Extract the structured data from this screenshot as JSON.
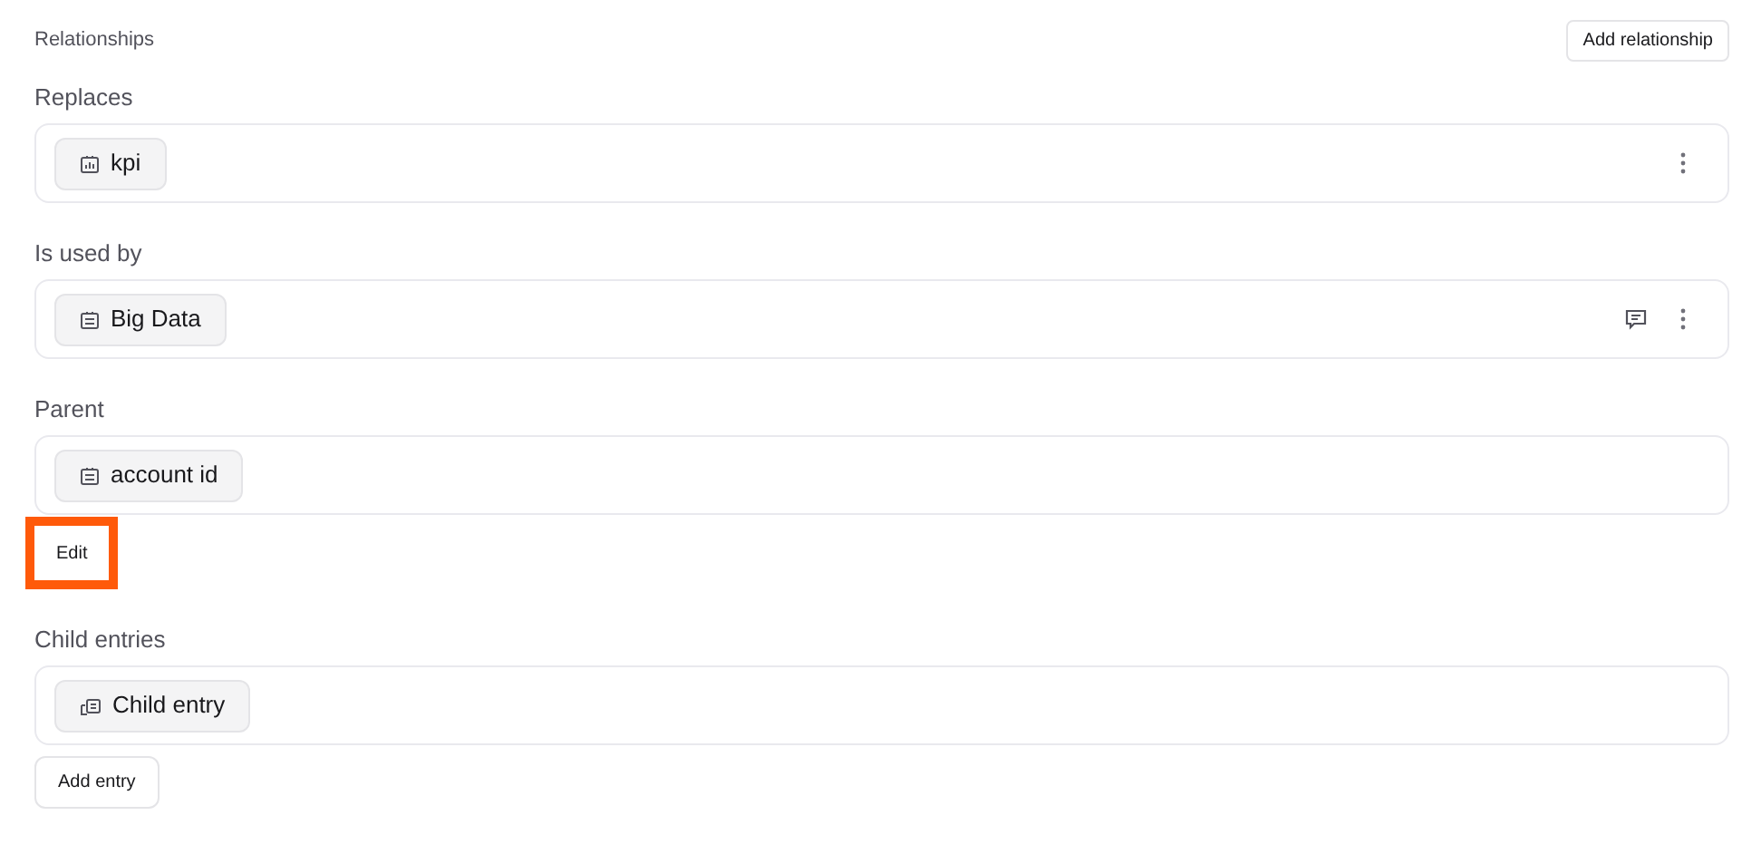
{
  "header": {
    "title": "Relationships",
    "button": "Add relationship"
  },
  "sections": [
    {
      "label": "Replaces",
      "entries": [
        {
          "label": "kpi",
          "kind": "chart"
        }
      ],
      "comment": false,
      "menu": true
    },
    {
      "label": "Is used by",
      "entries": [
        {
          "label": "Big Data",
          "kind": "list"
        }
      ],
      "comment": true,
      "menu": true
    },
    {
      "label": "Parent",
      "entries": [
        {
          "label": "account id",
          "kind": "list"
        }
      ],
      "comment": false,
      "menu": false,
      "button": {
        "label": "Edit",
        "highlighted": true
      }
    },
    {
      "label": "Child entries",
      "entries": [
        {
          "label": "Child entry",
          "kind": "child"
        }
      ],
      "comment": false,
      "menu": false,
      "button": {
        "label": "Add entry",
        "highlighted": false
      }
    }
  ]
}
